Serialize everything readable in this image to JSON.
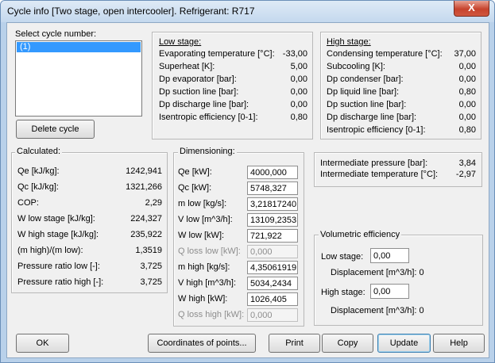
{
  "window": {
    "title": "Cycle info [Two stage, open intercooler]. Refrigerant: R717",
    "close_glyph": "X"
  },
  "select": {
    "label": "Select cycle number:",
    "items": [
      "(1)"
    ],
    "delete_label": "Delete cycle"
  },
  "low_stage": {
    "heading": "Low stage:",
    "rows": [
      {
        "label": "Evaporating temperature [°C]:",
        "value": "-33,00"
      },
      {
        "label": "Superheat [K]:",
        "value": "5,00"
      },
      {
        "label": "Dp evaporator [bar]:",
        "value": "0,00"
      },
      {
        "label": "Dp suction line [bar]:",
        "value": "0,00"
      },
      {
        "label": "Dp discharge line [bar]:",
        "value": "0,00"
      },
      {
        "label": "Isentropic efficiency [0-1]:",
        "value": "0,80"
      }
    ]
  },
  "high_stage": {
    "heading": "High stage:",
    "rows": [
      {
        "label": "Condensing temperature [°C]:",
        "value": "37,00"
      },
      {
        "label": "Subcooling [K]:",
        "value": "0,00"
      },
      {
        "label": "Dp condenser [bar]:",
        "value": "0,00"
      },
      {
        "label": "Dp liquid line [bar]:",
        "value": "0,80"
      },
      {
        "label": "Dp suction line [bar]:",
        "value": "0,00"
      },
      {
        "label": "Dp discharge line [bar]:",
        "value": "0,00"
      },
      {
        "label": "Isentropic efficiency [0-1]:",
        "value": "0,80"
      }
    ]
  },
  "calculated": {
    "legend": "Calculated:",
    "rows": [
      {
        "label": "Qe [kJ/kg]:",
        "value": "1242,941"
      },
      {
        "label": "Qc [kJ/kg]:",
        "value": "1321,266"
      },
      {
        "label": "COP:",
        "value": "2,29"
      },
      {
        "label": "W low stage [kJ/kg]:",
        "value": "224,327"
      },
      {
        "label": "W high stage [kJ/kg]:",
        "value": "235,922"
      },
      {
        "label": "(m high)/(m low):",
        "value": "1,3519"
      },
      {
        "label": "Pressure ratio low [-]:",
        "value": "3,725"
      },
      {
        "label": "Pressure ratio high [-]:",
        "value": "3,725"
      }
    ]
  },
  "dimensioning": {
    "legend": "Dimensioning:",
    "rows": [
      {
        "label": "Qe [kW]:",
        "value": "4000,000",
        "disabled": false
      },
      {
        "label": "Qc [kW]:",
        "value": "5748,327",
        "disabled": false
      },
      {
        "label": "m low [kg/s]:",
        "value": "3,21817240",
        "disabled": false
      },
      {
        "label": "V low [m^3/h]:",
        "value": "13109,2353",
        "disabled": false
      },
      {
        "label": "W low [kW]:",
        "value": "721,922",
        "disabled": false
      },
      {
        "label": "Q loss low [kW]:",
        "value": "0,000",
        "disabled": true
      },
      {
        "label": "m high [kg/s]:",
        "value": "4,35061919",
        "disabled": false
      },
      {
        "label": "V high [m^3/h]:",
        "value": "5034,2434",
        "disabled": false
      },
      {
        "label": "W high [kW]:",
        "value": "1026,405",
        "disabled": false
      },
      {
        "label": "Q loss high [kW]:",
        "value": "0,000",
        "disabled": true
      }
    ]
  },
  "intermediate": {
    "rows": [
      {
        "label": "Intermediate pressure [bar]:",
        "value": "3,84"
      },
      {
        "label": "Intermediate temperature [°C]:",
        "value": "-2,97"
      }
    ]
  },
  "volumetric": {
    "legend": "Volumetric efficiency",
    "low_label": "Low stage:",
    "low_value": "0,00",
    "low_disp": "Displacement [m^3/h]:  0",
    "high_label": "High stage:",
    "high_value": "0,00",
    "high_disp": "Displacement [m^3/h]:  0"
  },
  "buttons": {
    "ok": "OK",
    "coordinates": "Coordinates of points...",
    "print": "Print",
    "copy": "Copy",
    "update": "Update",
    "help": "Help"
  }
}
